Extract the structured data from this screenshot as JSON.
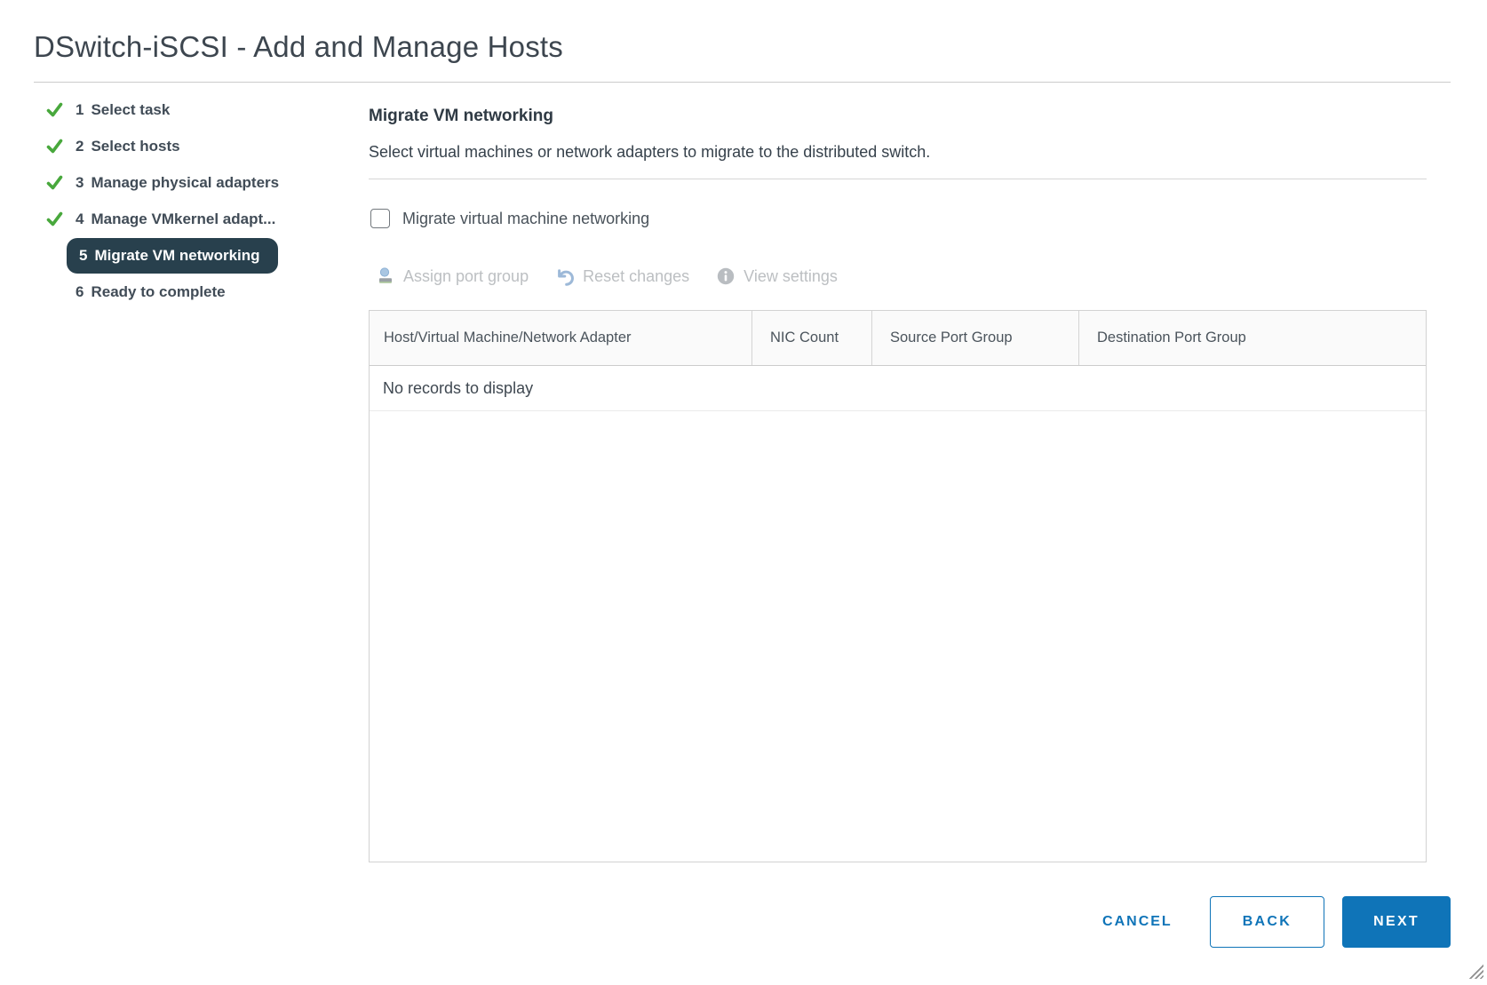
{
  "window": {
    "title": "DSwitch-iSCSI - Add and Manage Hosts"
  },
  "sidebar": {
    "steps": [
      {
        "number": "1",
        "label": "Select task",
        "status": "done"
      },
      {
        "number": "2",
        "label": "Select hosts",
        "status": "done"
      },
      {
        "number": "3",
        "label": "Manage physical adapters",
        "status": "done"
      },
      {
        "number": "4",
        "label": "Manage VMkernel adapt...",
        "status": "done"
      },
      {
        "number": "5",
        "label": "Migrate VM networking",
        "status": "active"
      },
      {
        "number": "6",
        "label": "Ready to complete",
        "status": "upcoming"
      }
    ]
  },
  "main": {
    "heading": "Migrate VM networking",
    "description": "Select virtual machines or network adapters to migrate to the distributed switch.",
    "checkbox": {
      "label": "Migrate virtual machine networking",
      "checked": false
    },
    "toolbar": [
      {
        "label": "Assign port group",
        "icon": "assign-port-group-icon",
        "enabled": false
      },
      {
        "label": "Reset changes",
        "icon": "reset-changes-icon",
        "enabled": false
      },
      {
        "label": "View settings",
        "icon": "view-settings-icon",
        "enabled": false
      }
    ],
    "table": {
      "columns": [
        "Host/Virtual Machine/Network Adapter",
        "NIC Count",
        "Source Port Group",
        "Destination Port Group"
      ],
      "rows": [],
      "empty_message": "No records to display"
    }
  },
  "footer": {
    "cancel_label": "CANCEL",
    "back_label": "BACK",
    "next_label": "NEXT"
  },
  "colors": {
    "accent_blue": "#0f74b8",
    "active_step_bg": "#28404d",
    "check_green": "#48a83c",
    "header_bg": "#fafafa",
    "border_gray": "#d2d2d2"
  }
}
